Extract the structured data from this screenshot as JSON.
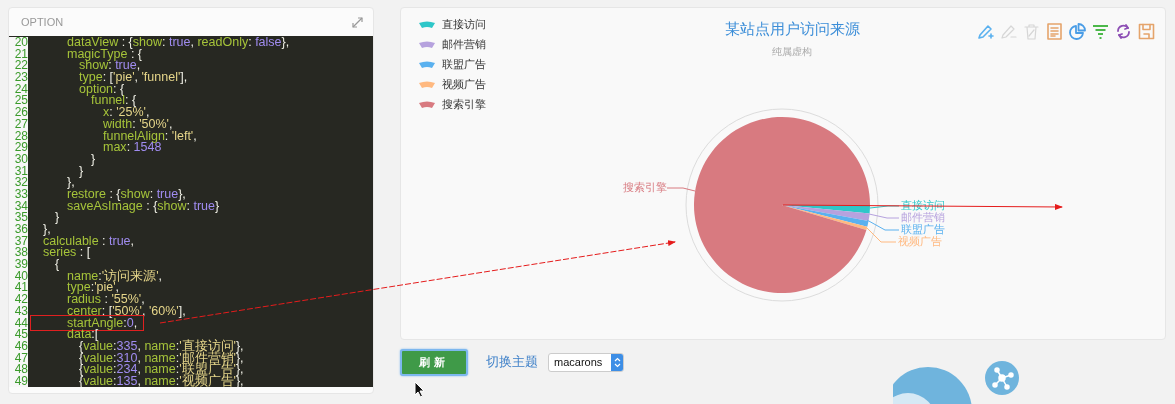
{
  "option_panel": {
    "title": "OPTION",
    "lines": [
      {
        "no": "20",
        "tokens": [
          {
            "kind": "key",
            "text": "\t\t\tdataView"
          },
          {
            "kind": "punc",
            "text": " : {"
          },
          {
            "kind": "key",
            "text": "show"
          },
          {
            "kind": "punc",
            "text": ": "
          },
          {
            "kind": "val",
            "text": "true"
          },
          {
            "kind": "punc",
            "text": ", "
          },
          {
            "kind": "key",
            "text": "readOnly"
          },
          {
            "kind": "punc",
            "text": ": "
          },
          {
            "kind": "val",
            "text": "false"
          },
          {
            "kind": "punc",
            "text": "},"
          }
        ]
      },
      {
        "no": "21",
        "tokens": [
          {
            "kind": "key",
            "text": "\t\t\tmagicType"
          },
          {
            "kind": "punc",
            "text": " : {"
          }
        ]
      },
      {
        "no": "22",
        "tokens": [
          {
            "kind": "key",
            "text": "\t\t\t\tshow"
          },
          {
            "kind": "punc",
            "text": ": "
          },
          {
            "kind": "val",
            "text": "true"
          },
          {
            "kind": "punc",
            "text": ","
          }
        ]
      },
      {
        "no": "23",
        "tokens": [
          {
            "kind": "key",
            "text": "\t\t\t\ttype"
          },
          {
            "kind": "punc",
            "text": ": ["
          },
          {
            "kind": "str",
            "text": "'pie'"
          },
          {
            "kind": "punc",
            "text": ", "
          },
          {
            "kind": "str",
            "text": "'funnel'"
          },
          {
            "kind": "punc",
            "text": "],"
          }
        ]
      },
      {
        "no": "24",
        "tokens": [
          {
            "kind": "key",
            "text": "\t\t\t\toption"
          },
          {
            "kind": "punc",
            "text": ": {"
          }
        ]
      },
      {
        "no": "25",
        "tokens": [
          {
            "kind": "key",
            "text": "\t\t\t\t\tfunnel"
          },
          {
            "kind": "punc",
            "text": ": {"
          }
        ]
      },
      {
        "no": "26",
        "tokens": [
          {
            "kind": "key",
            "text": "\t\t\t\t\t\tx"
          },
          {
            "kind": "punc",
            "text": ": "
          },
          {
            "kind": "str",
            "text": "'25%'"
          },
          {
            "kind": "punc",
            "text": ","
          }
        ]
      },
      {
        "no": "27",
        "tokens": [
          {
            "kind": "key",
            "text": "\t\t\t\t\t\twidth"
          },
          {
            "kind": "punc",
            "text": ": "
          },
          {
            "kind": "str",
            "text": "'50%'"
          },
          {
            "kind": "punc",
            "text": ","
          }
        ]
      },
      {
        "no": "28",
        "tokens": [
          {
            "kind": "key",
            "text": "\t\t\t\t\t\tfunnelAlign"
          },
          {
            "kind": "punc",
            "text": ": "
          },
          {
            "kind": "str",
            "text": "'left'"
          },
          {
            "kind": "punc",
            "text": ","
          }
        ]
      },
      {
        "no": "29",
        "tokens": [
          {
            "kind": "key",
            "text": "\t\t\t\t\t\tmax"
          },
          {
            "kind": "punc",
            "text": ": "
          },
          {
            "kind": "val",
            "text": "1548"
          }
        ]
      },
      {
        "no": "30",
        "tokens": [
          {
            "kind": "punc",
            "text": "\t\t\t\t\t}"
          }
        ]
      },
      {
        "no": "31",
        "tokens": [
          {
            "kind": "punc",
            "text": "\t\t\t\t}"
          }
        ]
      },
      {
        "no": "32",
        "tokens": [
          {
            "kind": "punc",
            "text": "\t\t\t},"
          }
        ]
      },
      {
        "no": "33",
        "tokens": [
          {
            "kind": "key",
            "text": "\t\t\trestore"
          },
          {
            "kind": "punc",
            "text": " : {"
          },
          {
            "kind": "key",
            "text": "show"
          },
          {
            "kind": "punc",
            "text": ": "
          },
          {
            "kind": "val",
            "text": "true"
          },
          {
            "kind": "punc",
            "text": "},"
          }
        ]
      },
      {
        "no": "34",
        "tokens": [
          {
            "kind": "key",
            "text": "\t\t\tsaveAsImage"
          },
          {
            "kind": "punc",
            "text": " : {"
          },
          {
            "kind": "key",
            "text": "show"
          },
          {
            "kind": "punc",
            "text": ": "
          },
          {
            "kind": "val",
            "text": "true"
          },
          {
            "kind": "punc",
            "text": "}"
          }
        ]
      },
      {
        "no": "35",
        "tokens": [
          {
            "kind": "punc",
            "text": "\t\t}"
          }
        ]
      },
      {
        "no": "36",
        "tokens": [
          {
            "kind": "punc",
            "text": "\t},"
          }
        ]
      },
      {
        "no": "37",
        "tokens": [
          {
            "kind": "key",
            "text": "\tcalculable"
          },
          {
            "kind": "punc",
            "text": " : "
          },
          {
            "kind": "val",
            "text": "true"
          },
          {
            "kind": "punc",
            "text": ","
          }
        ]
      },
      {
        "no": "38",
        "tokens": [
          {
            "kind": "key",
            "text": "\tseries"
          },
          {
            "kind": "punc",
            "text": " : ["
          }
        ]
      },
      {
        "no": "39",
        "tokens": [
          {
            "kind": "punc",
            "text": "\t\t{"
          }
        ]
      },
      {
        "no": "40",
        "tokens": [
          {
            "kind": "key",
            "text": "\t\t\tname"
          },
          {
            "kind": "punc",
            "text": ":"
          },
          {
            "kind": "str",
            "text": "'访问来源'"
          },
          {
            "kind": "punc",
            "text": ","
          }
        ]
      },
      {
        "no": "41",
        "tokens": [
          {
            "kind": "key",
            "text": "\t\t\ttype"
          },
          {
            "kind": "punc",
            "text": ":"
          },
          {
            "kind": "str",
            "text": "'pie'"
          },
          {
            "kind": "punc",
            "text": ","
          }
        ]
      },
      {
        "no": "42",
        "tokens": [
          {
            "kind": "key",
            "text": "\t\t\tradius"
          },
          {
            "kind": "punc",
            "text": " : "
          },
          {
            "kind": "str",
            "text": "'55%'"
          },
          {
            "kind": "punc",
            "text": ","
          }
        ]
      },
      {
        "no": "43",
        "tokens": [
          {
            "kind": "key",
            "text": "\t\t\tcenter"
          },
          {
            "kind": "punc",
            "text": ": ["
          },
          {
            "kind": "str",
            "text": "'50%'"
          },
          {
            "kind": "punc",
            "text": ", "
          },
          {
            "kind": "str",
            "text": "'60%'"
          },
          {
            "kind": "punc",
            "text": "],"
          }
        ]
      },
      {
        "no": "44",
        "boxed": true,
        "tokens": [
          {
            "kind": "key",
            "text": "\t\t\tstartAngle"
          },
          {
            "kind": "punc",
            "text": ":"
          },
          {
            "kind": "val",
            "text": "0"
          },
          {
            "kind": "punc",
            "text": ","
          }
        ]
      },
      {
        "no": "45",
        "tokens": [
          {
            "kind": "key",
            "text": "\t\t\tdata"
          },
          {
            "kind": "punc",
            "text": ":["
          }
        ]
      },
      {
        "no": "46",
        "tokens": [
          {
            "kind": "punc",
            "text": "\t\t\t\t{"
          },
          {
            "kind": "key",
            "text": "value"
          },
          {
            "kind": "punc",
            "text": ":"
          },
          {
            "kind": "val",
            "text": "335"
          },
          {
            "kind": "punc",
            "text": ", "
          },
          {
            "kind": "key",
            "text": "name"
          },
          {
            "kind": "punc",
            "text": ":"
          },
          {
            "kind": "str",
            "text": "'直接访问'"
          },
          {
            "kind": "punc",
            "text": "},"
          }
        ]
      },
      {
        "no": "47",
        "tokens": [
          {
            "kind": "punc",
            "text": "\t\t\t\t{"
          },
          {
            "kind": "key",
            "text": "value"
          },
          {
            "kind": "punc",
            "text": ":"
          },
          {
            "kind": "val",
            "text": "310"
          },
          {
            "kind": "punc",
            "text": ", "
          },
          {
            "kind": "key",
            "text": "name"
          },
          {
            "kind": "punc",
            "text": ":"
          },
          {
            "kind": "str",
            "text": "'邮件营销'"
          },
          {
            "kind": "punc",
            "text": "},"
          }
        ]
      },
      {
        "no": "48",
        "tokens": [
          {
            "kind": "punc",
            "text": "\t\t\t\t{"
          },
          {
            "kind": "key",
            "text": "value"
          },
          {
            "kind": "punc",
            "text": ":"
          },
          {
            "kind": "val",
            "text": "234"
          },
          {
            "kind": "punc",
            "text": ", "
          },
          {
            "kind": "key",
            "text": "name"
          },
          {
            "kind": "punc",
            "text": ":"
          },
          {
            "kind": "str",
            "text": "'联盟广告'"
          },
          {
            "kind": "punc",
            "text": "},"
          }
        ]
      },
      {
        "no": "49",
        "tokens": [
          {
            "kind": "punc",
            "text": "\t\t\t\t{"
          },
          {
            "kind": "key",
            "text": "value"
          },
          {
            "kind": "punc",
            "text": ":"
          },
          {
            "kind": "val",
            "text": "135"
          },
          {
            "kind": "punc",
            "text": ", "
          },
          {
            "kind": "key",
            "text": "name"
          },
          {
            "kind": "punc",
            "text": ":"
          },
          {
            "kind": "str",
            "text": "'视频广告'"
          },
          {
            "kind": "punc",
            "text": "},"
          }
        ]
      }
    ]
  },
  "chart_panel": {
    "title": "某站点用户访问来源",
    "subtitle": "纯属虚构",
    "legend": [
      {
        "label": "直接访问",
        "color": "#2ec7c9"
      },
      {
        "label": "邮件营销",
        "color": "#b6a2de"
      },
      {
        "label": "联盟广告",
        "color": "#5ab1ef"
      },
      {
        "label": "视频广告",
        "color": "#ffb980"
      },
      {
        "label": "搜索引擎",
        "color": "#d87a80"
      }
    ],
    "toolbar": [
      {
        "kind": "mark",
        "disabled": false
      },
      {
        "kind": "mark-undo",
        "disabled": true
      },
      {
        "kind": "mark-clear",
        "disabled": true
      },
      {
        "kind": "data-view",
        "disabled": false
      },
      {
        "kind": "pie",
        "disabled": false
      },
      {
        "kind": "funnel",
        "disabled": false
      },
      {
        "kind": "restore",
        "disabled": false
      },
      {
        "kind": "save",
        "disabled": false
      }
    ],
    "pie_labels": [
      {
        "label": "直接访问",
        "color": "#2ec7c9"
      },
      {
        "label": "邮件营销",
        "color": "#b6a2de"
      },
      {
        "label": "联盟广告",
        "color": "#5ab1ef"
      },
      {
        "label": "视频广告",
        "color": "#ffb980"
      },
      {
        "label": "搜索引擎",
        "color": "#d87a80"
      }
    ]
  },
  "controls": {
    "refresh_button": "刷新",
    "theme_label": "切换主题",
    "theme_select": "macarons"
  },
  "annotations": [
    {
      "kind": "arrow",
      "dashed": true
    },
    {
      "kind": "arrow",
      "dashed": false
    }
  ]
}
